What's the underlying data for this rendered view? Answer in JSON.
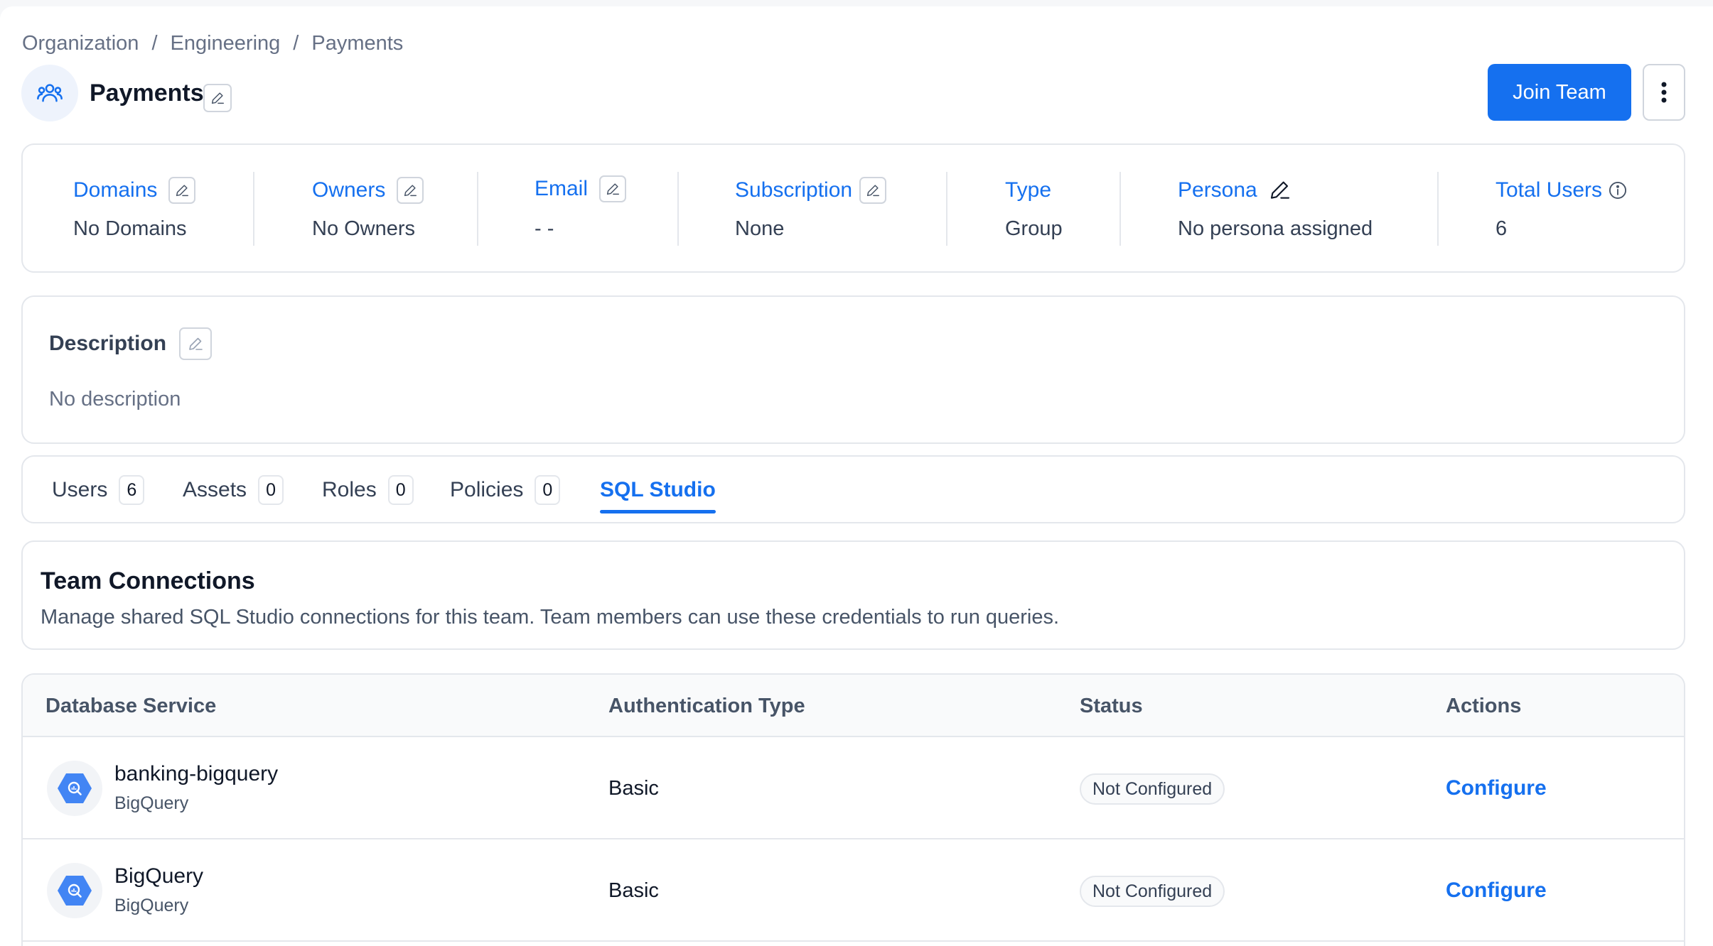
{
  "breadcrumb": [
    "Organization",
    "Engineering",
    "Payments"
  ],
  "header": {
    "title": "Payments",
    "join_label": "Join Team"
  },
  "info": {
    "domains": {
      "label": "Domains",
      "value": "No Domains"
    },
    "owners": {
      "label": "Owners",
      "value": "No Owners"
    },
    "email": {
      "label": "Email",
      "value": "- -"
    },
    "subscription": {
      "label": "Subscription",
      "value": "None"
    },
    "type": {
      "label": "Type",
      "value": "Group"
    },
    "persona": {
      "label": "Persona",
      "value": "No persona assigned"
    },
    "total_users": {
      "label": "Total Users",
      "value": "6"
    }
  },
  "description": {
    "title": "Description",
    "text": "No description"
  },
  "tabs": [
    {
      "label": "Users",
      "count": "6"
    },
    {
      "label": "Assets",
      "count": "0"
    },
    {
      "label": "Roles",
      "count": "0"
    },
    {
      "label": "Policies",
      "count": "0"
    },
    {
      "label": "SQL Studio",
      "active": true
    }
  ],
  "connections": {
    "title": "Team Connections",
    "subtitle": "Manage shared SQL Studio connections for this team. Team members can use these credentials to run queries."
  },
  "table": {
    "headers": [
      "Database Service",
      "Authentication Type",
      "Status",
      "Actions"
    ],
    "rows": [
      {
        "name": "banking-bigquery",
        "service_type": "BigQuery",
        "auth": "Basic",
        "status": "Not Configured",
        "action": "Configure"
      },
      {
        "name": "BigQuery",
        "service_type": "BigQuery",
        "auth": "Basic",
        "status": "Not Configured",
        "action": "Configure"
      }
    ]
  },
  "colors": {
    "accent": "#1570ef",
    "border": "#e4e7ec",
    "avatar_bg": "#eef3fc",
    "bigquery": "#4285f4"
  },
  "icons": {
    "team": "team-icon",
    "edit": "pencil-icon",
    "more": "more-vertical-icon",
    "info": "info-circle-icon",
    "bigquery": "bigquery-icon"
  }
}
